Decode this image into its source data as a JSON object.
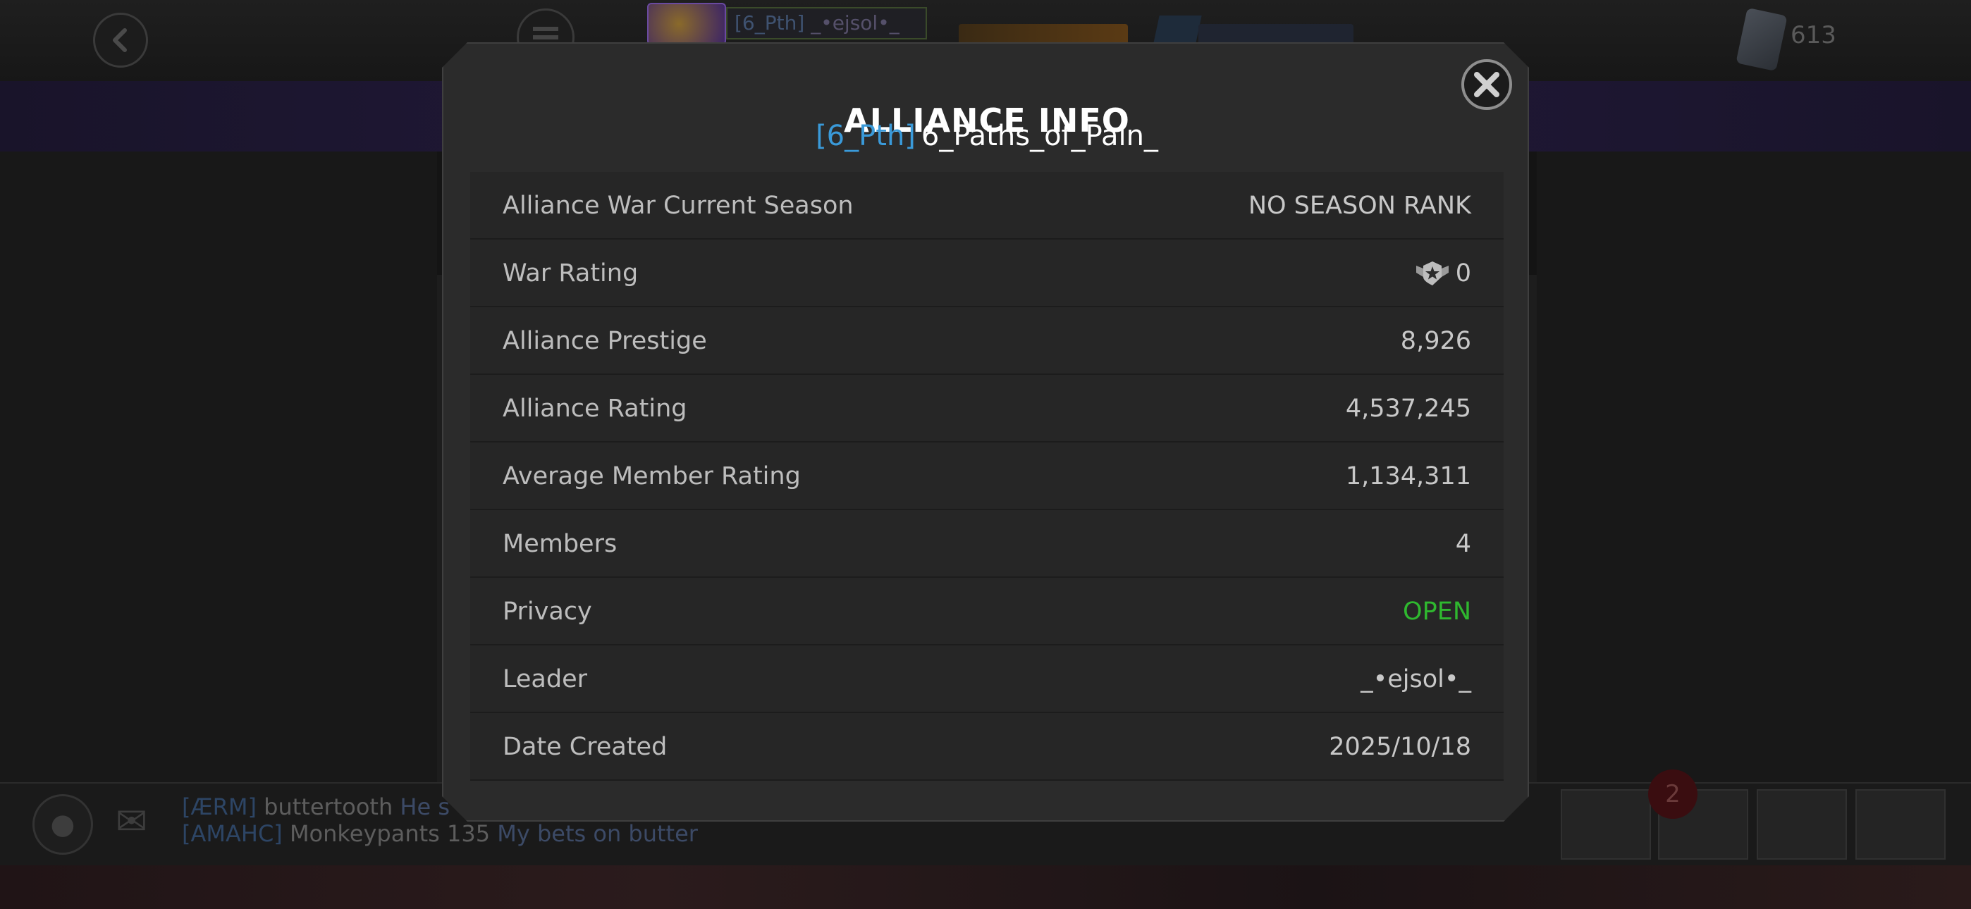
{
  "background": {
    "hud": {
      "player_tag": "[6_Pth]",
      "player_name": "_•ejsol•_",
      "units_count": "613"
    },
    "chat": {
      "lines": [
        {
          "tag": "[ÆRM]",
          "user": "buttertooth",
          "message": "He s"
        },
        {
          "tag": "[AMAHC]",
          "user": "Monkeypants 135",
          "message": "My bets on butter"
        }
      ]
    },
    "dock": {
      "badge_count": "2"
    }
  },
  "modal": {
    "title": "ALLIANCE INFO",
    "alliance_tag": "[6_Pth]",
    "alliance_name": "6_Paths_of_Pain_",
    "rows": [
      {
        "label": "Alliance War Current Season",
        "value": "NO SEASON RANK"
      },
      {
        "label": "War Rating",
        "value": "0",
        "icon": "war-rating-badge-icon"
      },
      {
        "label": "Alliance Prestige",
        "value": "8,926"
      },
      {
        "label": "Alliance Rating",
        "value": "4,537,245"
      },
      {
        "label": "Average Member Rating",
        "value": "1,134,311"
      },
      {
        "label": "Members",
        "value": "4"
      },
      {
        "label": "Privacy",
        "value": "OPEN",
        "value_color": "#2fb82f"
      },
      {
        "label": "Leader",
        "value": "_•ejsol•_"
      },
      {
        "label": "Date Created",
        "value": "2025/10/18"
      }
    ]
  },
  "colors": {
    "tag_blue": "#3a9ad9",
    "open_green": "#2fb82f",
    "modal_bg": "#2b2b2b",
    "row_bg": "#262626"
  }
}
